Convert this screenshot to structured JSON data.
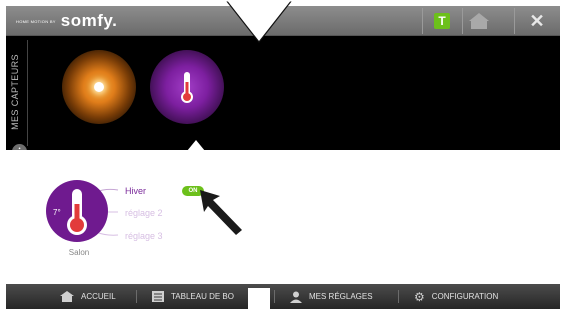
{
  "header": {
    "logo_prefix": "home motion by",
    "logo_brand": "somfy.",
    "buttons": [
      "t-icon",
      "home-icon",
      "close-icon"
    ]
  },
  "sensors": {
    "title": "MES CAPTEURS",
    "items": [
      {
        "icon": "sun-icon",
        "color": "#e07d1a"
      },
      {
        "icon": "thermometer-icon",
        "color": "#7d1fa0",
        "selected": true
      }
    ]
  },
  "detail": {
    "temperature": "7°",
    "room": "Salon",
    "modes": [
      {
        "label": "Hiver",
        "active": true
      },
      {
        "label": "réglage 2",
        "active": false
      },
      {
        "label": "réglage 3",
        "active": false
      }
    ],
    "toggle": "ON"
  },
  "nav": {
    "items": [
      {
        "label": "ACCUEIL",
        "icon": "home-icon"
      },
      {
        "label": "TABLEAU DE BO",
        "icon": "dashboard-icon"
      },
      {
        "label": "MES RÉGLAGES",
        "icon": "user-icon"
      },
      {
        "label": "CONFIGURATION",
        "icon": "gear-icon"
      }
    ]
  },
  "colors": {
    "accent_purple": "#7d1fa0",
    "accent_green": "#6cc01b",
    "accent_orange": "#e07d1a"
  }
}
